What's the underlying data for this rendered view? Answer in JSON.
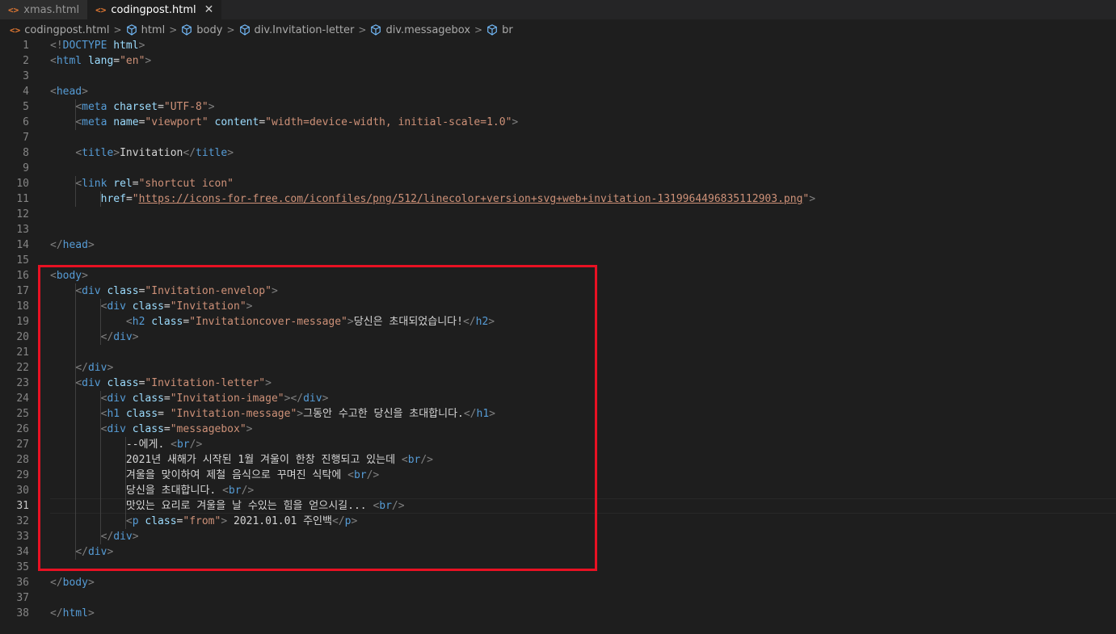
{
  "tabs": [
    {
      "label": "xmas.html",
      "active": false
    },
    {
      "label": "codingpost.html",
      "active": true
    }
  ],
  "tab_icon": "<>",
  "breadcrumb": [
    "codingpost.html",
    "html",
    "body",
    "div.Invitation-letter",
    "div.messagebox",
    "br"
  ],
  "current_line": 31,
  "highlight_color": "#e81123",
  "lines": [
    {
      "n": "1",
      "segs": [
        [
          "p",
          "<!"
        ],
        [
          "t",
          "DOCTYPE"
        ],
        [
          "x",
          " "
        ],
        [
          "a",
          "html"
        ],
        [
          "p",
          ">"
        ]
      ]
    },
    {
      "n": "2",
      "segs": [
        [
          "p",
          "<"
        ],
        [
          "t",
          "html"
        ],
        [
          "x",
          " "
        ],
        [
          "a",
          "lang"
        ],
        [
          "x",
          "="
        ],
        [
          "v",
          "\"en\""
        ],
        [
          "p",
          ">"
        ]
      ]
    },
    {
      "n": "3",
      "segs": []
    },
    {
      "n": "4",
      "segs": [
        [
          "p",
          "<"
        ],
        [
          "t",
          "head"
        ],
        [
          "p",
          ">"
        ]
      ]
    },
    {
      "n": "5",
      "segs": [
        [
          "x",
          "    "
        ],
        [
          "p",
          "<"
        ],
        [
          "t",
          "meta"
        ],
        [
          "x",
          " "
        ],
        [
          "a",
          "charset"
        ],
        [
          "x",
          "="
        ],
        [
          "v",
          "\"UTF-8\""
        ],
        [
          "p",
          ">"
        ]
      ]
    },
    {
      "n": "6",
      "segs": [
        [
          "x",
          "    "
        ],
        [
          "p",
          "<"
        ],
        [
          "t",
          "meta"
        ],
        [
          "x",
          " "
        ],
        [
          "a",
          "name"
        ],
        [
          "x",
          "="
        ],
        [
          "v",
          "\"viewport\""
        ],
        [
          "x",
          " "
        ],
        [
          "a",
          "content"
        ],
        [
          "x",
          "="
        ],
        [
          "v",
          "\"width=device-width, initial-scale=1.0\""
        ],
        [
          "p",
          ">"
        ]
      ]
    },
    {
      "n": "7",
      "segs": []
    },
    {
      "n": "8",
      "segs": [
        [
          "x",
          "    "
        ],
        [
          "p",
          "<"
        ],
        [
          "t",
          "title"
        ],
        [
          "p",
          ">"
        ],
        [
          "x",
          "Invitation"
        ],
        [
          "p",
          "</"
        ],
        [
          "t",
          "title"
        ],
        [
          "p",
          ">"
        ]
      ]
    },
    {
      "n": "9",
      "segs": []
    },
    {
      "n": "10",
      "segs": [
        [
          "x",
          "    "
        ],
        [
          "p",
          "<"
        ],
        [
          "t",
          "link"
        ],
        [
          "x",
          " "
        ],
        [
          "a",
          "rel"
        ],
        [
          "x",
          "="
        ],
        [
          "v",
          "\"shortcut icon\""
        ]
      ]
    },
    {
      "n": "11",
      "segs": [
        [
          "x",
          "        "
        ],
        [
          "a",
          "href"
        ],
        [
          "x",
          "="
        ],
        [
          "v",
          "\""
        ],
        [
          "u",
          "https://icons-for-free.com/iconfiles/png/512/linecolor+version+svg+web+invitation-1319964496835112903.png"
        ],
        [
          "v",
          "\""
        ],
        [
          "p",
          ">"
        ]
      ]
    },
    {
      "n": "12",
      "segs": []
    },
    {
      "n": "13",
      "segs": []
    },
    {
      "n": "14",
      "segs": [
        [
          "p",
          "</"
        ],
        [
          "t",
          "head"
        ],
        [
          "p",
          ">"
        ]
      ]
    },
    {
      "n": "15",
      "segs": []
    },
    {
      "n": "16",
      "segs": [
        [
          "p",
          "<"
        ],
        [
          "t",
          "body"
        ],
        [
          "p",
          ">"
        ]
      ]
    },
    {
      "n": "17",
      "segs": [
        [
          "x",
          "    "
        ],
        [
          "p",
          "<"
        ],
        [
          "t",
          "div"
        ],
        [
          "x",
          " "
        ],
        [
          "a",
          "class"
        ],
        [
          "x",
          "="
        ],
        [
          "v",
          "\"Invitation-envelop\""
        ],
        [
          "p",
          ">"
        ]
      ]
    },
    {
      "n": "18",
      "segs": [
        [
          "x",
          "        "
        ],
        [
          "p",
          "<"
        ],
        [
          "t",
          "div"
        ],
        [
          "x",
          " "
        ],
        [
          "a",
          "class"
        ],
        [
          "x",
          "="
        ],
        [
          "v",
          "\"Invitation\""
        ],
        [
          "p",
          ">"
        ]
      ]
    },
    {
      "n": "19",
      "segs": [
        [
          "x",
          "            "
        ],
        [
          "p",
          "<"
        ],
        [
          "t",
          "h2"
        ],
        [
          "x",
          " "
        ],
        [
          "a",
          "class"
        ],
        [
          "x",
          "="
        ],
        [
          "v",
          "\"Invitationcover-message\""
        ],
        [
          "p",
          ">"
        ],
        [
          "x",
          "당신은 초대되었습니다!"
        ],
        [
          "p",
          "</"
        ],
        [
          "t",
          "h2"
        ],
        [
          "p",
          ">"
        ]
      ]
    },
    {
      "n": "20",
      "segs": [
        [
          "x",
          "        "
        ],
        [
          "p",
          "</"
        ],
        [
          "t",
          "div"
        ],
        [
          "p",
          ">"
        ]
      ]
    },
    {
      "n": "21",
      "segs": []
    },
    {
      "n": "22",
      "segs": [
        [
          "x",
          "    "
        ],
        [
          "p",
          "</"
        ],
        [
          "t",
          "div"
        ],
        [
          "p",
          ">"
        ]
      ]
    },
    {
      "n": "23",
      "segs": [
        [
          "x",
          "    "
        ],
        [
          "p",
          "<"
        ],
        [
          "t",
          "div"
        ],
        [
          "x",
          " "
        ],
        [
          "a",
          "class"
        ],
        [
          "x",
          "="
        ],
        [
          "v",
          "\"Invitation-letter\""
        ],
        [
          "p",
          ">"
        ]
      ]
    },
    {
      "n": "24",
      "segs": [
        [
          "x",
          "        "
        ],
        [
          "p",
          "<"
        ],
        [
          "t",
          "div"
        ],
        [
          "x",
          " "
        ],
        [
          "a",
          "class"
        ],
        [
          "x",
          "="
        ],
        [
          "v",
          "\"Invitation-image\""
        ],
        [
          "p",
          "></"
        ],
        [
          "t",
          "div"
        ],
        [
          "p",
          ">"
        ]
      ]
    },
    {
      "n": "25",
      "segs": [
        [
          "x",
          "        "
        ],
        [
          "p",
          "<"
        ],
        [
          "t",
          "h1"
        ],
        [
          "x",
          " "
        ],
        [
          "a",
          "class"
        ],
        [
          "x",
          "= "
        ],
        [
          "v",
          "\"Invitation-message\""
        ],
        [
          "p",
          ">"
        ],
        [
          "x",
          "그동안 수고한 당신을 초대합니다."
        ],
        [
          "p",
          "</"
        ],
        [
          "t",
          "h1"
        ],
        [
          "p",
          ">"
        ]
      ]
    },
    {
      "n": "26",
      "segs": [
        [
          "x",
          "        "
        ],
        [
          "p",
          "<"
        ],
        [
          "t",
          "div"
        ],
        [
          "x",
          " "
        ],
        [
          "a",
          "class"
        ],
        [
          "x",
          "="
        ],
        [
          "v",
          "\"messagebox\""
        ],
        [
          "p",
          ">"
        ]
      ]
    },
    {
      "n": "27",
      "segs": [
        [
          "x",
          "            --에게. "
        ],
        [
          "p",
          "<"
        ],
        [
          "t",
          "br"
        ],
        [
          "p",
          "/>"
        ]
      ]
    },
    {
      "n": "28",
      "segs": [
        [
          "x",
          "            2021년 새해가 시작된 1월 겨울이 한창 진행되고 있는데 "
        ],
        [
          "p",
          "<"
        ],
        [
          "t",
          "br"
        ],
        [
          "p",
          "/>"
        ]
      ]
    },
    {
      "n": "29",
      "segs": [
        [
          "x",
          "            겨울을 맞이하여 제철 음식으로 꾸며진 식탁에 "
        ],
        [
          "p",
          "<"
        ],
        [
          "t",
          "br"
        ],
        [
          "p",
          "/>"
        ]
      ]
    },
    {
      "n": "30",
      "segs": [
        [
          "x",
          "            당신을 초대합니다. "
        ],
        [
          "p",
          "<"
        ],
        [
          "t",
          "br"
        ],
        [
          "p",
          "/>"
        ]
      ]
    },
    {
      "n": "31",
      "segs": [
        [
          "x",
          "            맛있는 요리로 겨울을 날 수있는 힘을 얻으시길... "
        ],
        [
          "p",
          "<"
        ],
        [
          "t",
          "br"
        ],
        [
          "p",
          "/>"
        ]
      ]
    },
    {
      "n": "32",
      "segs": [
        [
          "x",
          "            "
        ],
        [
          "p",
          "<"
        ],
        [
          "t",
          "p"
        ],
        [
          "x",
          " "
        ],
        [
          "a",
          "class"
        ],
        [
          "x",
          "="
        ],
        [
          "v",
          "\"from\""
        ],
        [
          "p",
          ">"
        ],
        [
          "x",
          " 2021.01.01 주인백"
        ],
        [
          "p",
          "</"
        ],
        [
          "t",
          "p"
        ],
        [
          "p",
          ">"
        ]
      ]
    },
    {
      "n": "33",
      "segs": [
        [
          "x",
          "        "
        ],
        [
          "p",
          "</"
        ],
        [
          "t",
          "div"
        ],
        [
          "p",
          ">"
        ]
      ]
    },
    {
      "n": "34",
      "segs": [
        [
          "x",
          "    "
        ],
        [
          "p",
          "</"
        ],
        [
          "t",
          "div"
        ],
        [
          "p",
          ">"
        ]
      ]
    },
    {
      "n": "35",
      "segs": []
    },
    {
      "n": "36",
      "segs": [
        [
          "p",
          "</"
        ],
        [
          "t",
          "body"
        ],
        [
          "p",
          ">"
        ]
      ]
    },
    {
      "n": "37",
      "segs": []
    },
    {
      "n": "38",
      "segs": [
        [
          "p",
          "</"
        ],
        [
          "t",
          "html"
        ],
        [
          "p",
          ">"
        ]
      ]
    }
  ]
}
